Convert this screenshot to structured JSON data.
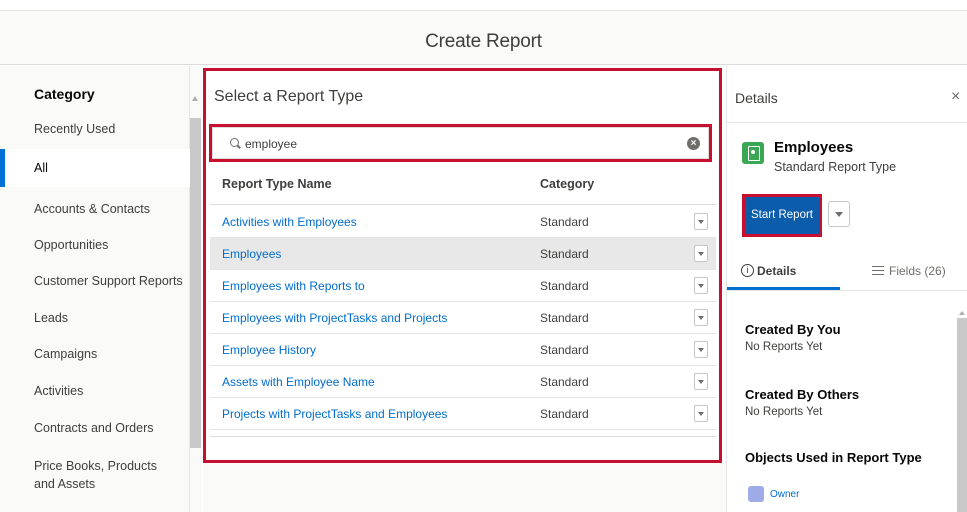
{
  "dialog": {
    "title": "Create Report"
  },
  "category_panel": {
    "heading": "Category",
    "items": [
      {
        "label": "Recently Used"
      },
      {
        "label": "All",
        "selected": true
      },
      {
        "label": "Accounts & Contacts"
      },
      {
        "label": "Opportunities"
      },
      {
        "label": "Customer Support Reports"
      },
      {
        "label": "Leads"
      },
      {
        "label": "Campaigns"
      },
      {
        "label": "Activities"
      },
      {
        "label": "Contracts and Orders"
      },
      {
        "label": "Price Books, Products and Assets"
      }
    ]
  },
  "report_type_panel": {
    "heading": "Select a Report Type",
    "search": {
      "value": "employee",
      "clear_icon": "clear-icon",
      "search_icon": "search-icon"
    },
    "columns": [
      "Report Type Name",
      "Category"
    ],
    "rows": [
      {
        "name": "Activities with Employees",
        "category": "Standard"
      },
      {
        "name": "Employees",
        "category": "Standard",
        "selected": true
      },
      {
        "name": "Employees with Reports to",
        "category": "Standard"
      },
      {
        "name": "Employees with ProjectTasks and Projects",
        "category": "Standard"
      },
      {
        "name": "Employee History",
        "category": "Standard"
      },
      {
        "name": "Assets with Employee Name",
        "category": "Standard"
      },
      {
        "name": "Projects with ProjectTasks and Employees",
        "category": "Standard"
      }
    ]
  },
  "details_panel": {
    "heading": "Details",
    "close_label": "×",
    "report_type": {
      "name": "Employees",
      "subtitle": "Standard Report Type",
      "icon": "report-type-icon",
      "icon_color": "#3ba755"
    },
    "start_button": "Start Report",
    "tabs": [
      {
        "label": "Details",
        "active": true
      },
      {
        "label": "Fields (26)"
      }
    ],
    "sections": [
      {
        "heading": "Created By You",
        "text": "No Reports Yet"
      },
      {
        "heading": "Created By Others",
        "text": "No Reports Yet"
      },
      {
        "heading": "Objects Used in Report Type"
      }
    ],
    "objects": [
      {
        "label": "Owner"
      }
    ]
  },
  "colors": {
    "accent": "#0070d2",
    "link": "#006dcc",
    "highlight_box": "#c8102e",
    "primary_button": "#0b5cab"
  }
}
